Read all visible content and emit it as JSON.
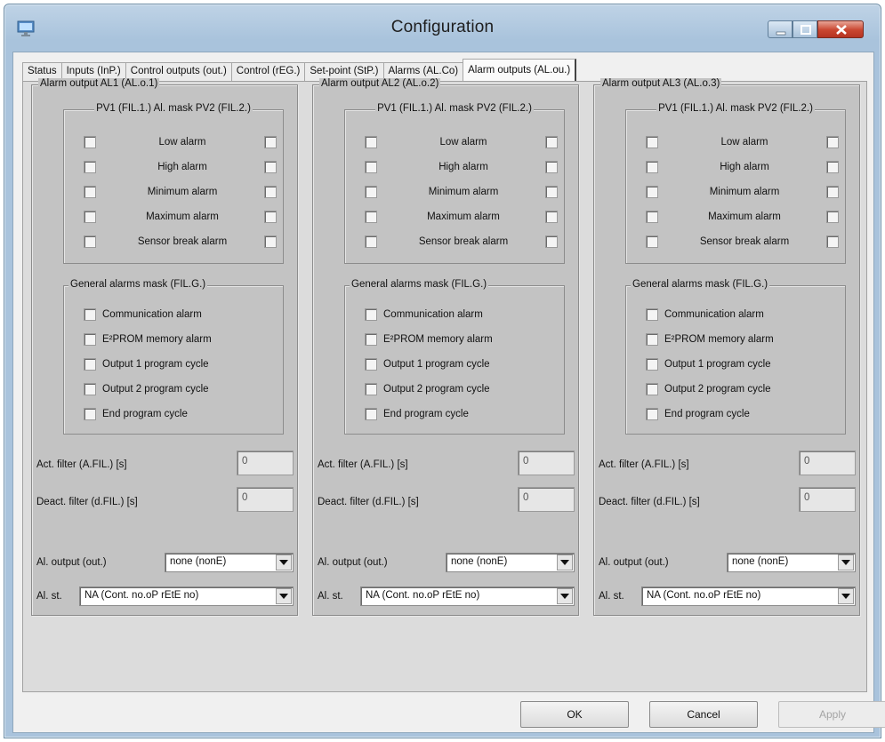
{
  "window": {
    "title": "Configuration"
  },
  "tabs": [
    {
      "label": "Status"
    },
    {
      "label": "Inputs (InP.)"
    },
    {
      "label": "Control outputs (out.)"
    },
    {
      "label": "Control (rEG.)"
    },
    {
      "label": "Set-point (StP.)"
    },
    {
      "label": "Alarms (AL.Co)"
    },
    {
      "label": "Alarm outputs (AL.ou.)",
      "active": true
    }
  ],
  "columns": [
    {
      "title": "Alarm output AL1 (AL.o.1)",
      "mask_header": "PV1 (FIL.1.) Al. mask PV2 (FIL.2.)",
      "mask_rows": [
        "Low alarm",
        "High alarm",
        "Minimum alarm",
        "Maximum alarm",
        "Sensor break alarm"
      ],
      "general_header": "General alarms mask (FIL.G.)",
      "general_rows": [
        "Communication alarm",
        "E²PROM memory alarm",
        "Output 1 program cycle",
        "Output 2 program cycle",
        "End program cycle"
      ],
      "act_filter_label": "Act. filter (A.FIL.) [s]",
      "act_filter_value": "0",
      "deact_filter_label": "Deact. filter (d.FIL.) [s]",
      "deact_filter_value": "0",
      "al_output_label": "Al. output (out.)",
      "al_output_value": "none (nonE)",
      "al_st_label": "Al. st.",
      "al_st_value": "NA (Cont. no.oP  rEtE no)"
    },
    {
      "title": "Alarm output AL2 (AL.o.2)",
      "mask_header": "PV1 (FIL.1.) Al. mask PV2 (FIL.2.)",
      "mask_rows": [
        "Low alarm",
        "High alarm",
        "Minimum alarm",
        "Maximum alarm",
        "Sensor break alarm"
      ],
      "general_header": "General alarms mask (FIL.G.)",
      "general_rows": [
        "Communication alarm",
        "E²PROM memory alarm",
        "Output 1 program cycle",
        "Output 2 program cycle",
        "End program cycle"
      ],
      "act_filter_label": "Act. filter (A.FIL.) [s]",
      "act_filter_value": "0",
      "deact_filter_label": "Deact. filter (d.FIL.) [s]",
      "deact_filter_value": "0",
      "al_output_label": "Al. output (out.)",
      "al_output_value": "none (nonE)",
      "al_st_label": "Al. st.",
      "al_st_value": "NA (Cont. no.oP  rEtE no)"
    },
    {
      "title": "Alarm output AL3 (AL.o.3)",
      "mask_header": "PV1 (FIL.1.) Al. mask PV2 (FIL.2.)",
      "mask_rows": [
        "Low alarm",
        "High alarm",
        "Minimum alarm",
        "Maximum alarm",
        "Sensor break alarm"
      ],
      "general_header": "General alarms mask (FIL.G.)",
      "general_rows": [
        "Communication alarm",
        "E²PROM memory alarm",
        "Output 1 program cycle",
        "Output 2 program cycle",
        "End program cycle"
      ],
      "act_filter_label": "Act. filter (A.FIL.) [s]",
      "act_filter_value": "0",
      "deact_filter_label": "Deact. filter (d.FIL.) [s]",
      "deact_filter_value": "0",
      "al_output_label": "Al. output (out.)",
      "al_output_value": "none (nonE)",
      "al_st_label": "Al. st.",
      "al_st_value": "NA (Cont. no.oP  rEtE no)"
    }
  ],
  "buttons": {
    "ok": "OK",
    "cancel": "Cancel",
    "apply": "Apply"
  }
}
